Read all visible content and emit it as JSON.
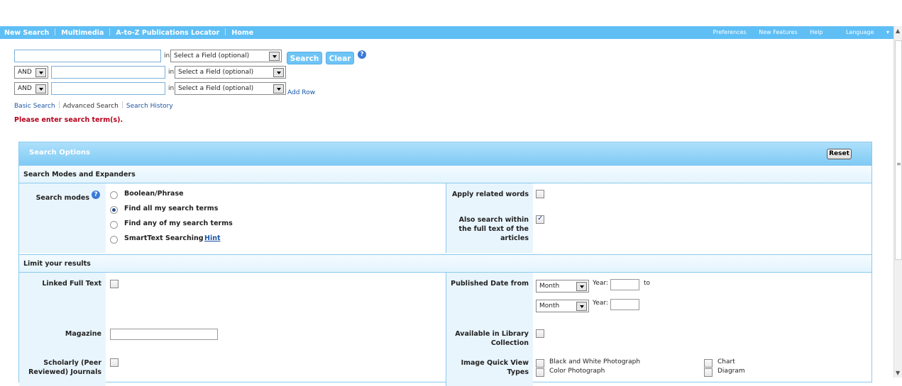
{
  "nav": {
    "left": [
      "New Search",
      "Multimedia",
      "A-to-Z Publications Locator",
      "Home"
    ],
    "right": [
      "Preferences",
      "New Features",
      "Help",
      "Language"
    ]
  },
  "search": {
    "in_label": "in",
    "field_placeholder": "Select a Field (optional)",
    "bool_op": "AND",
    "search_btn": "Search",
    "clear_btn": "Clear",
    "add_row": "Add Row",
    "help": "?"
  },
  "links": {
    "basic": "Basic Search",
    "advanced": "Advanced Search",
    "history": "Search History"
  },
  "error": "Please enter search term(s).",
  "options": {
    "title": "Search Options",
    "reset": "Reset",
    "modes_section": "Search Modes and Expanders",
    "modes_label": "Search modes",
    "modes": [
      "Boolean/Phrase",
      "Find all my search terms",
      "Find any of my search terms",
      "SmartText Searching"
    ],
    "hint": "Hint",
    "apply_related": "Apply related words",
    "also_search": "Also search within the full text of the articles",
    "limit_section": "Limit your results",
    "linked_full_text": "Linked Full Text",
    "published_date": "Published Date from",
    "month": "Month",
    "year": "Year:",
    "to": "to",
    "magazine": "Magazine",
    "available_library": "Available in Library Collection",
    "scholarly": "Scholarly (Peer Reviewed) Journals",
    "image_quick_view": "Image Quick View Types",
    "image_types": [
      "Black and White Photograph",
      "Color Photograph",
      "Chart",
      "Diagram"
    ]
  }
}
